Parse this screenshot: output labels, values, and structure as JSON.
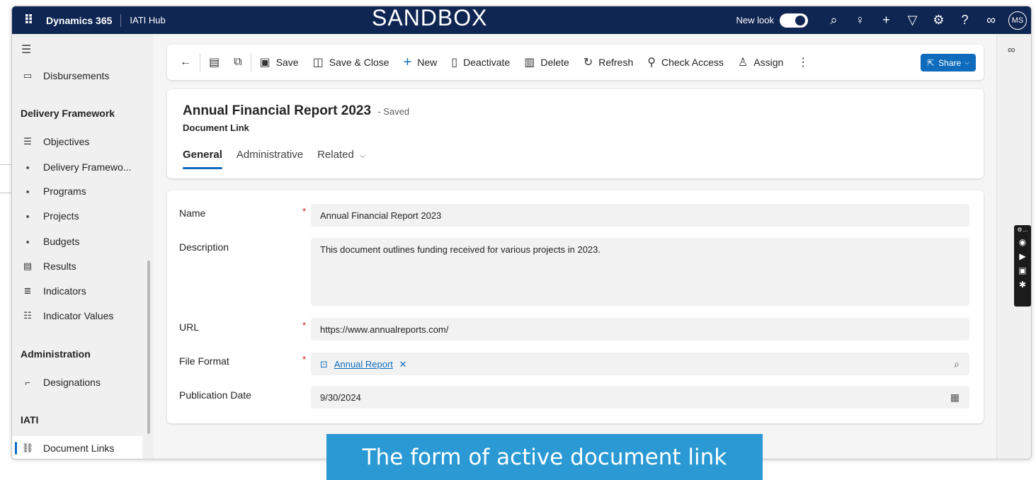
{
  "topbar": {
    "app_name": "Dynamics 365",
    "hub_name": "IATI Hub",
    "environment_label": "SANDBOX",
    "new_look_label": "New look",
    "user_initials": "MS"
  },
  "sidebar": {
    "items_top": [
      {
        "label": "Disbursements"
      }
    ],
    "group_delivery": "Delivery Framework",
    "items_delivery": [
      {
        "label": "Objectives"
      },
      {
        "label": "Delivery Framewo..."
      },
      {
        "label": "Programs"
      },
      {
        "label": "Projects"
      },
      {
        "label": "Budgets"
      },
      {
        "label": "Results"
      },
      {
        "label": "Indicators"
      },
      {
        "label": "Indicator Values"
      }
    ],
    "group_admin": "Administration",
    "items_admin": [
      {
        "label": "Designations"
      }
    ],
    "group_iati": "IATI",
    "items_iati": [
      {
        "label": "Document Links"
      }
    ]
  },
  "commandbar": {
    "save": "Save",
    "save_close": "Save & Close",
    "new": "New",
    "deactivate": "Deactivate",
    "delete": "Delete",
    "refresh": "Refresh",
    "check_access": "Check Access",
    "assign": "Assign",
    "share": "Share"
  },
  "record": {
    "title": "Annual Financial Report 2023",
    "status": "- Saved",
    "entity": "Document Link",
    "tabs": [
      "General",
      "Administrative",
      "Related"
    ]
  },
  "form": {
    "name_label": "Name",
    "name_value": "Annual Financial Report 2023",
    "description_label": "Description",
    "description_value": "This document outlines funding received for various projects in 2023.",
    "url_label": "URL",
    "url_value": "https://www.annualreports.com/",
    "file_format_label": "File Format",
    "file_format_value": "Annual Report",
    "publication_date_label": "Publication Date",
    "publication_date_value": "9/30/2024"
  },
  "caption": "The form of active document link",
  "colors": {
    "topbar": "#0f2552",
    "accent": "#0f6cbd",
    "caption_bg": "#2b9ad4",
    "required": "#c50f1f"
  }
}
